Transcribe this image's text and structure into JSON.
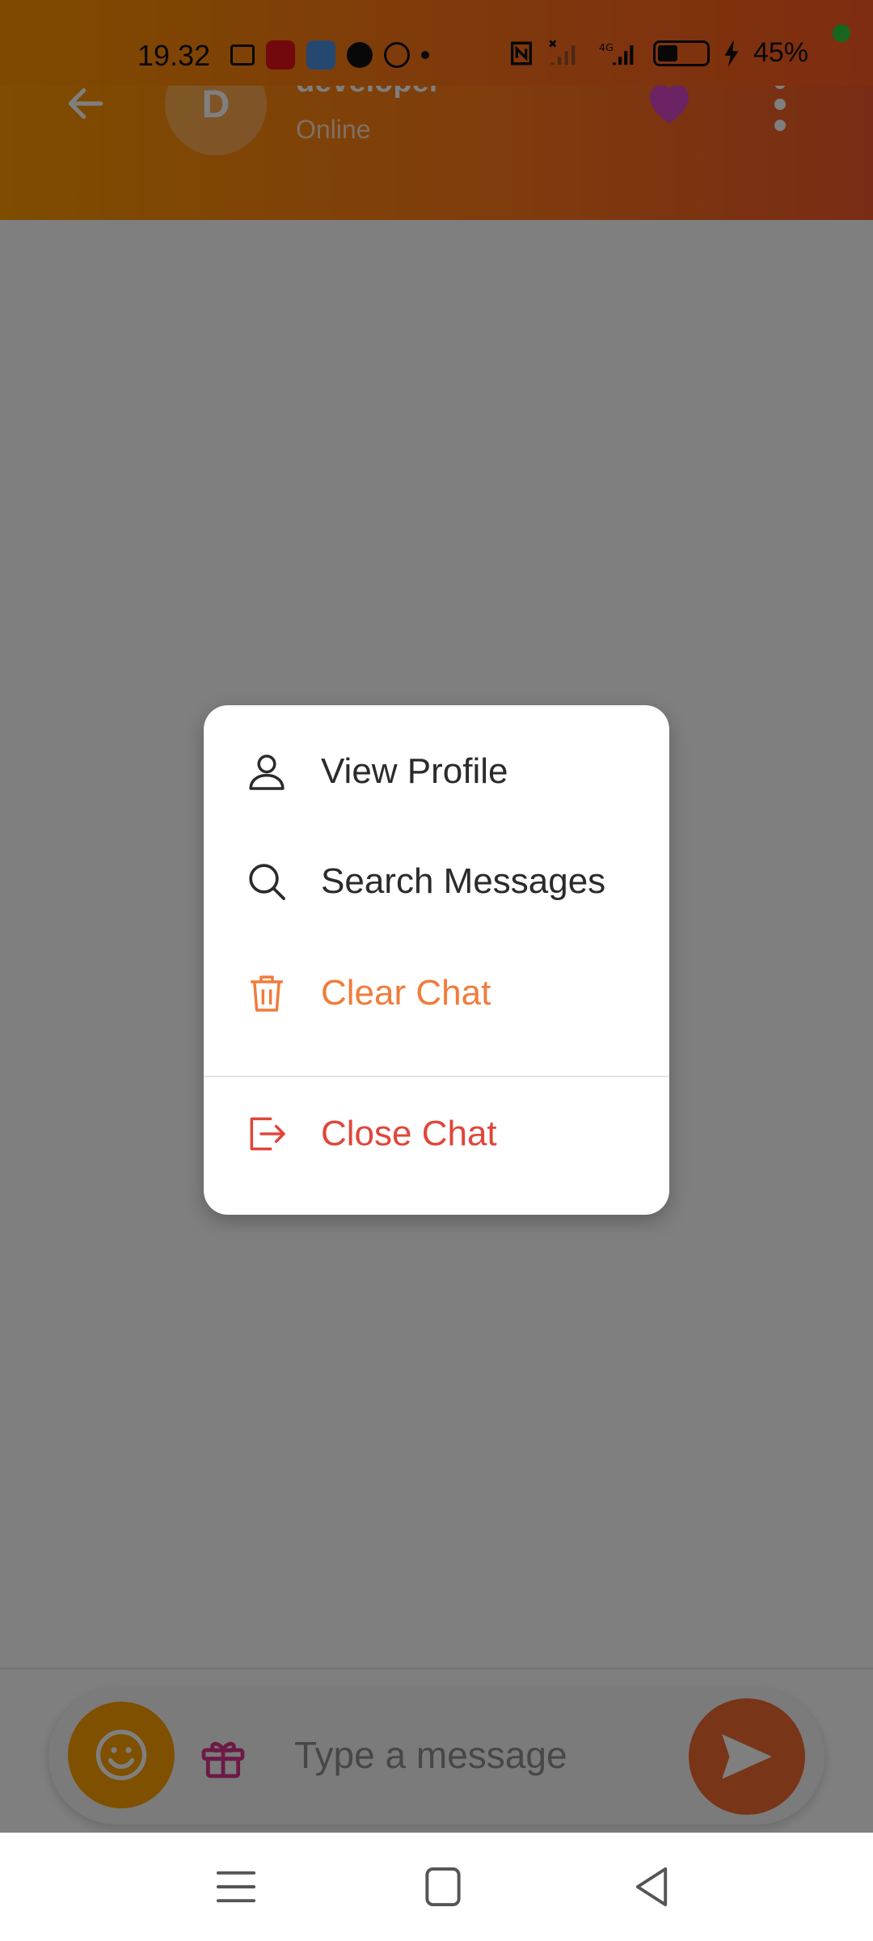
{
  "status_bar": {
    "time": "19.32",
    "battery_percent": "45%"
  },
  "header": {
    "avatar_letter": "D",
    "contact_name": "developer",
    "contact_status": "Online"
  },
  "menu": {
    "items": [
      {
        "label": "View Profile",
        "icon": "person-icon"
      },
      {
        "label": "Search Messages",
        "icon": "search-icon"
      },
      {
        "label": "Clear Chat",
        "icon": "trash-icon"
      },
      {
        "label": "Close Chat",
        "icon": "logout-icon"
      }
    ]
  },
  "composer": {
    "placeholder": "Type a message"
  },
  "colors": {
    "header_gradient_start": "#ff9800",
    "header_gradient_end": "#f2592a",
    "menu_text": "#2b2b2b",
    "clear_chat": "#f07c3c",
    "close_chat": "#e0463a",
    "emoji_button": "#ffa000",
    "send_button": "#f26a2e",
    "gift_icon": "#d8348a",
    "heart_icon": "#d846c8"
  }
}
